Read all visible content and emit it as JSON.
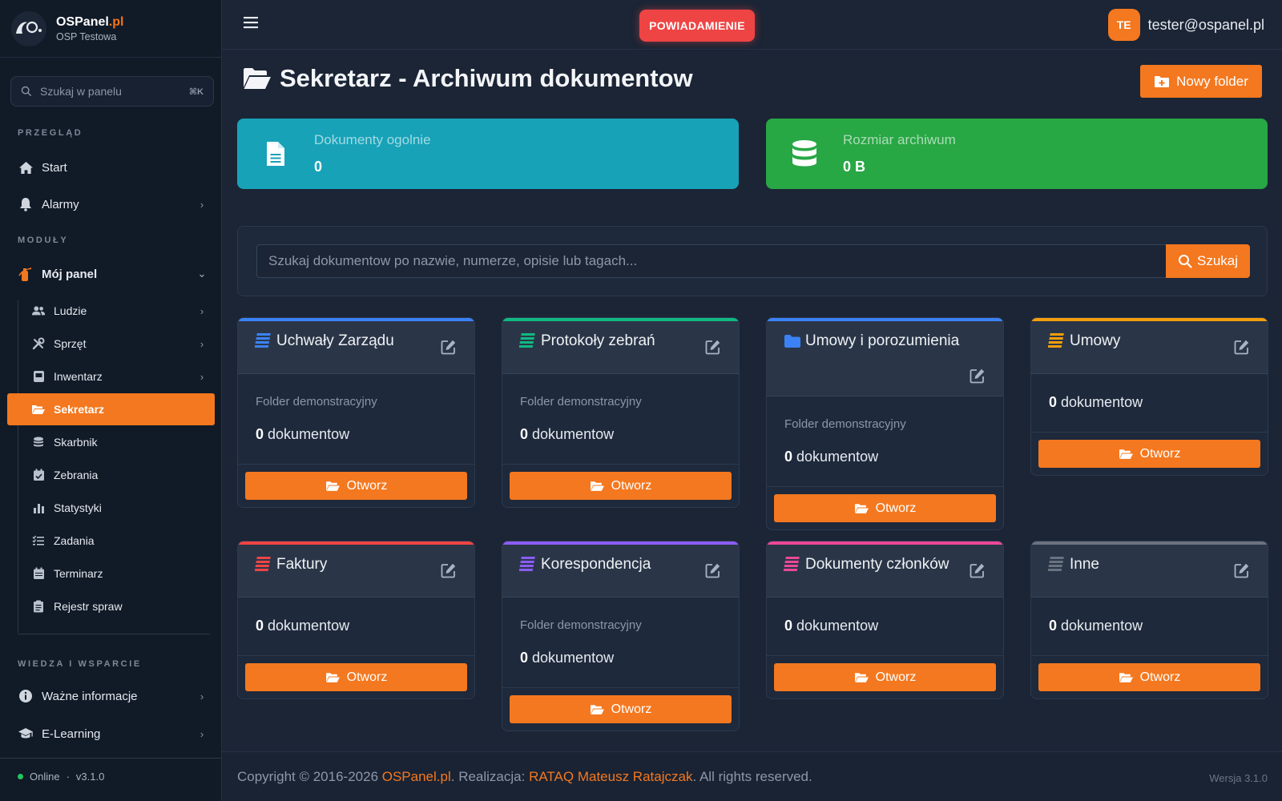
{
  "brand": {
    "name_main": "OSPanel",
    "name_accent": ".pl",
    "subtitle": "OSP Testowa"
  },
  "sidebar": {
    "search_placeholder": "Szukaj w panelu",
    "search_shortcut": "⌘K",
    "sections": {
      "overview": "PRZEGLĄD",
      "modules": "MODUŁY",
      "knowledge": "WIEDZA I WSPARCIE"
    },
    "overview_items": [
      {
        "label": "Start",
        "icon": "home-icon"
      },
      {
        "label": "Alarmy",
        "icon": "bell-icon"
      }
    ],
    "modules_parent": {
      "label": "Mój panel",
      "icon": "fire-extinguisher-icon"
    },
    "module_items": [
      {
        "label": "Ludzie",
        "icon": "users-icon",
        "has_children": true
      },
      {
        "label": "Sprzęt",
        "icon": "tools-icon",
        "has_children": true
      },
      {
        "label": "Inwentarz",
        "icon": "box-icon",
        "has_children": true
      },
      {
        "label": "Sekretarz",
        "icon": "folder-open-icon",
        "active": true
      },
      {
        "label": "Skarbnik",
        "icon": "coins-icon"
      },
      {
        "label": "Zebrania",
        "icon": "calendar-check-icon"
      },
      {
        "label": "Statystyki",
        "icon": "bar-chart-icon"
      },
      {
        "label": "Zadania",
        "icon": "tasks-icon"
      },
      {
        "label": "Terminarz",
        "icon": "calendar-icon"
      },
      {
        "label": "Rejestr spraw",
        "icon": "clipboard-icon"
      }
    ],
    "knowledge_items": [
      {
        "label": "Ważne informacje",
        "icon": "info-circle-icon"
      },
      {
        "label": "E-Learning",
        "icon": "graduation-cap-icon"
      }
    ],
    "status": {
      "online": "Online",
      "separator": "·",
      "version": "v3.1.0"
    }
  },
  "topbar": {
    "notification_label": "POWIADAMIENIE",
    "user_initials": "TE",
    "user_email": "tester@ospanel.pl"
  },
  "page": {
    "title": "Sekretarz - Archiwum dokumentow",
    "new_folder_label": "Nowy folder"
  },
  "stats": [
    {
      "label": "Dokumenty ogolnie",
      "value": "0",
      "color": "#17a2b8",
      "icon": "file-icon"
    },
    {
      "label": "Rozmiar archiwum",
      "value": "0 B",
      "color": "#28a745",
      "icon": "database-icon"
    }
  ],
  "search": {
    "placeholder": "Szukaj dokumentow po nazwie, numerze, opisie lub tagach...",
    "button_label": "Szukaj"
  },
  "folders": [
    {
      "name": "Uchwały Zarządu",
      "color": "#3b82f6",
      "icon": "list-icon",
      "description": "Folder demonstracyjny",
      "count": "0",
      "count_label": "dokumentow",
      "open_label": "Otworz"
    },
    {
      "name": "Protokoły zebrań",
      "color": "#10b981",
      "icon": "list-icon",
      "description": "Folder demonstracyjny",
      "count": "0",
      "count_label": "dokumentow",
      "open_label": "Otworz"
    },
    {
      "name": "Umowy i porozumienia",
      "color": "#3b82f6",
      "icon": "folder-icon",
      "description": "Folder demonstracyjny",
      "count": "0",
      "count_label": "dokumentow",
      "open_label": "Otworz"
    },
    {
      "name": "Umowy",
      "color": "#f59e0b",
      "icon": "list-icon",
      "description": "",
      "count": "0",
      "count_label": "dokumentow",
      "open_label": "Otworz"
    },
    {
      "name": "Faktury",
      "color": "#ef4444",
      "icon": "list-icon",
      "description": "",
      "count": "0",
      "count_label": "dokumentow",
      "open_label": "Otworz"
    },
    {
      "name": "Korespondencja",
      "color": "#8b5cf6",
      "icon": "list-icon",
      "description": "Folder demonstracyjny",
      "count": "0",
      "count_label": "dokumentow",
      "open_label": "Otworz"
    },
    {
      "name": "Dokumenty członków",
      "color": "#ec4899",
      "icon": "list-icon",
      "description": "",
      "count": "0",
      "count_label": "dokumentow",
      "open_label": "Otworz"
    },
    {
      "name": "Inne",
      "color": "#6b7280",
      "icon": "list-icon",
      "description": "",
      "count": "0",
      "count_label": "dokumentow",
      "open_label": "Otworz"
    }
  ],
  "footer": {
    "copy_prefix": "Copyright © 2016-2026 ",
    "copy_brand": "OSPanel.pl",
    "copy_mid": ". Realizacja: ",
    "copy_author": "RATAQ Mateusz Ratajczak",
    "copy_suffix": ". All rights reserved.",
    "version": "Wersja 3.1.0"
  },
  "colors": {
    "accent": "#f4781f",
    "notification": "#ef4444",
    "sidebar_bg": "#111a27",
    "main_bg": "#1b2535"
  }
}
